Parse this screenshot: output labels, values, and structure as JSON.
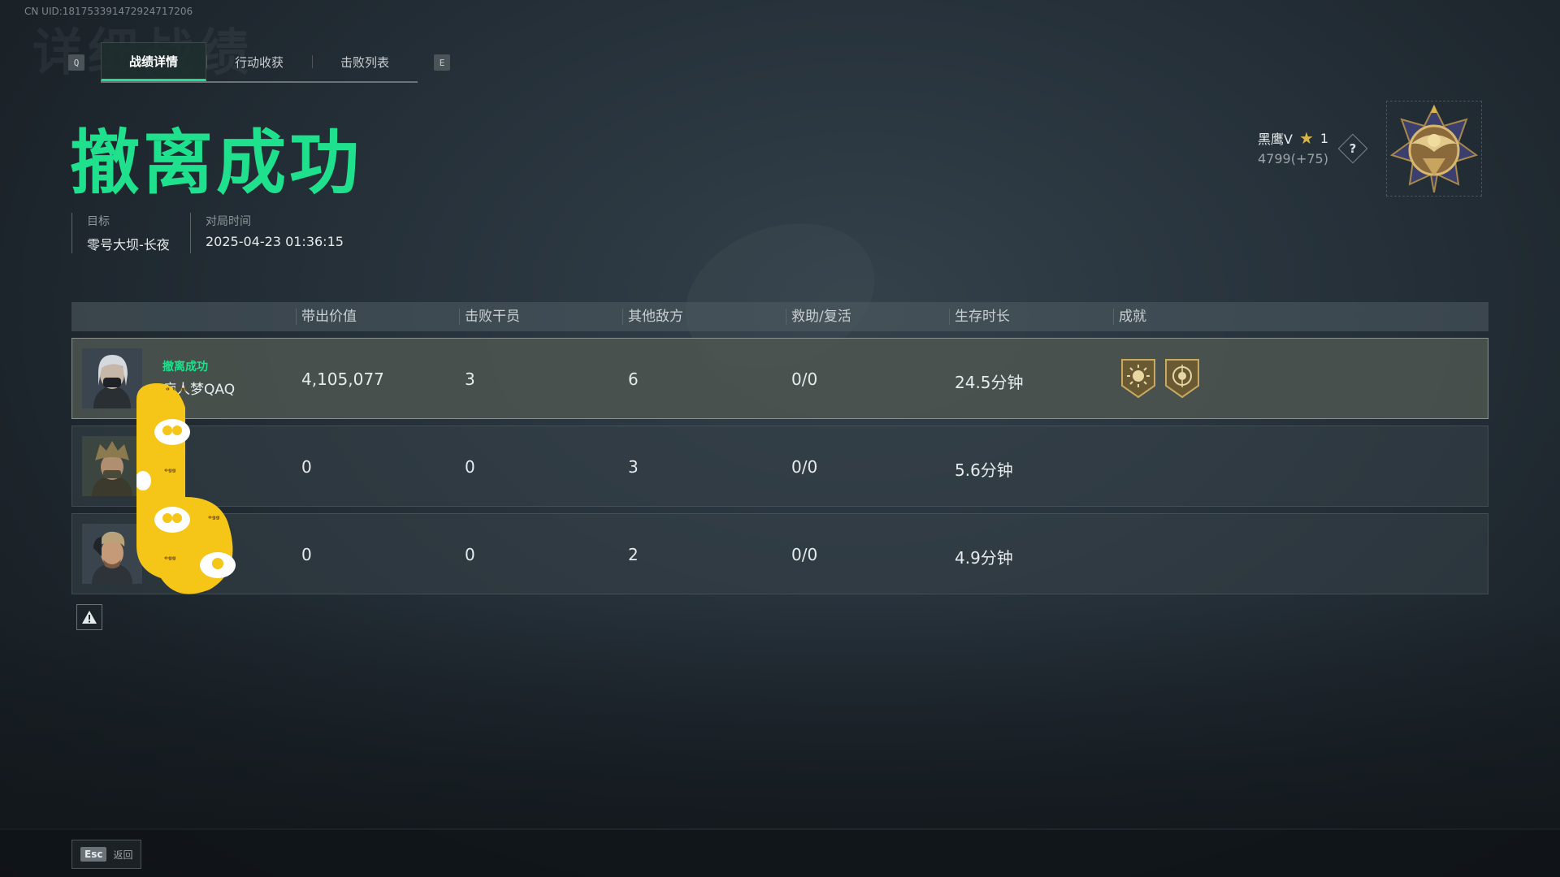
{
  "uid_label": "CN UID:181753391472924717206",
  "tabs": {
    "prev_key": "Q",
    "next_key": "E",
    "items": [
      {
        "label": "战绩详情",
        "active": true
      },
      {
        "label": "行动收获",
        "active": false
      },
      {
        "label": "击败列表",
        "active": false
      }
    ]
  },
  "result_title": "撤离成功",
  "meta": {
    "target_label": "目标",
    "target_value": "零号大坝-长夜",
    "time_label": "对局时间",
    "time_value": "2025-04-23 01:36:15"
  },
  "rank": {
    "name": "黑鹰V",
    "stars": "1",
    "score": "4799(+75)",
    "help": "?",
    "badge_icon": "eagle-rank-badge-icon"
  },
  "table": {
    "headers": [
      "带出价值",
      "击败干员",
      "其他敌方",
      "救助/复活",
      "生存时长",
      "成就"
    ],
    "rows": [
      {
        "status": "撤离成功",
        "name": "痴人梦QAQ",
        "value": "4,105,077",
        "operator_kills": "3",
        "other_kills": "6",
        "assists": "0/0",
        "survival": "24.5分钟",
        "achievements": [
          "sun-medal-icon",
          "target-medal-icon"
        ]
      },
      {
        "status": "",
        "name": "",
        "value": "0",
        "operator_kills": "0",
        "other_kills": "3",
        "assists": "0/0",
        "survival": "5.6分钟",
        "achievements": []
      },
      {
        "status": "",
        "name": "",
        "value": "0",
        "operator_kills": "0",
        "other_kills": "2",
        "assists": "0/0",
        "survival": "4.9分钟",
        "achievements": []
      }
    ]
  },
  "footer": {
    "esc_key": "Esc",
    "back_label": "返回"
  },
  "colors": {
    "accent": "#1fe08d",
    "gold": "#d9b44a"
  }
}
